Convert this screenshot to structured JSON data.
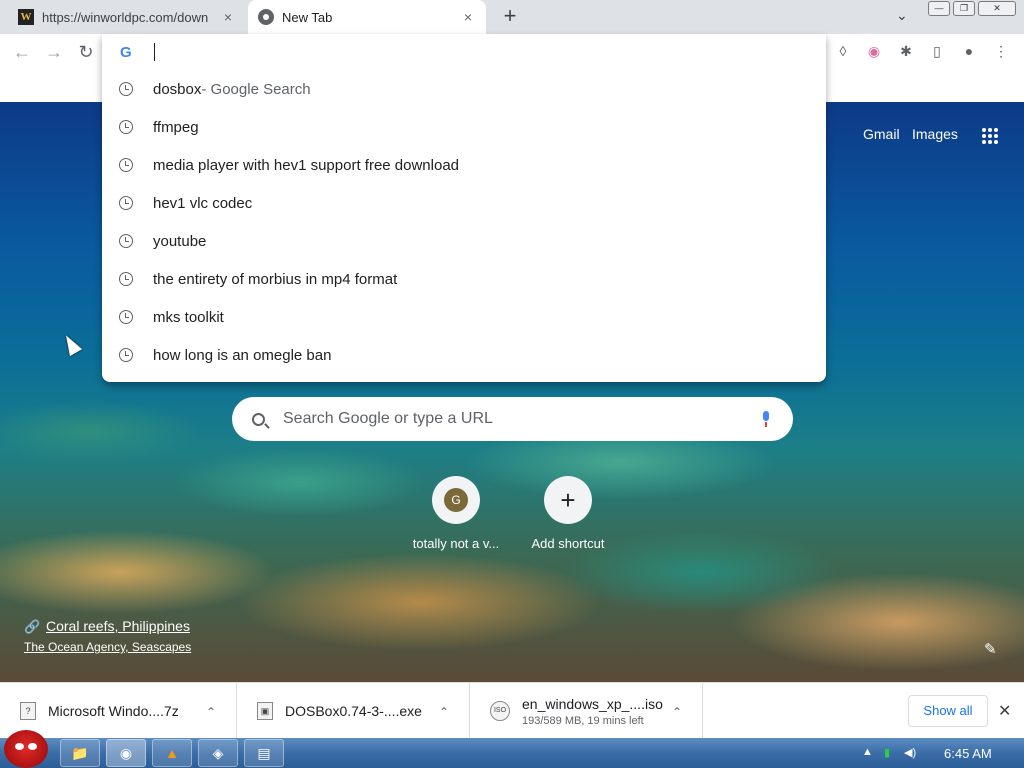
{
  "tabs": [
    {
      "favicon": "W",
      "title": "https://winworldpc.com/down",
      "close": "×"
    },
    {
      "favicon": "",
      "title": "New Tab",
      "close": "×"
    }
  ],
  "new_tab": "+",
  "tab_overflow": "⌄",
  "window": {
    "minimize": "—",
    "restore": "❐",
    "close": "✕"
  },
  "nav": {
    "back": "←",
    "forward": "→",
    "reload": "↻"
  },
  "extensions": {
    "ublock": "◊",
    "profile_ext": "◉",
    "puzzle": "✱",
    "sidebar": "▯",
    "account": "●",
    "menu": "⋮"
  },
  "omnibox": {
    "google_icon": "G",
    "value": "",
    "suggestions": [
      {
        "text": "dosbox",
        "suffix": " - Google Search"
      },
      {
        "text": "ffmpeg",
        "suffix": ""
      },
      {
        "text": "media player with hev1 support free download",
        "suffix": ""
      },
      {
        "text": "hev1 vlc codec",
        "suffix": ""
      },
      {
        "text": "youtube",
        "suffix": ""
      },
      {
        "text": "the entirety of morbius in mp4 format",
        "suffix": ""
      },
      {
        "text": "mks toolkit",
        "suffix": ""
      },
      {
        "text": "how long is an omegle ban",
        "suffix": ""
      }
    ]
  },
  "ntp": {
    "gmail": "Gmail",
    "images": "Images",
    "search_placeholder": "Search Google or type a URL",
    "shortcuts": [
      {
        "icon": "G",
        "label": "totally not a v..."
      },
      {
        "icon": "+",
        "label": "Add shortcut"
      }
    ],
    "credit_title": "Coral reefs, Philippines",
    "credit_author": "The Ocean Agency, Seascapes",
    "edit_icon": "✎"
  },
  "downloads": {
    "items": [
      {
        "icon": "?",
        "name": "Microsoft Windo....7z",
        "status": ""
      },
      {
        "icon": "▣",
        "name": "DOSBox0.74-3-....exe",
        "status": ""
      },
      {
        "icon": "ISO",
        "name": "en_windows_xp_....iso",
        "status": "193/589 MB, 19 mins left"
      }
    ],
    "show_all": "Show all",
    "close": "✕"
  },
  "taskbar": {
    "buttons": [
      "📁",
      "◉",
      "▲",
      "◈",
      "▤"
    ],
    "tray": [
      "▲",
      "▮",
      "◀)"
    ],
    "time": "6:45 AM"
  }
}
